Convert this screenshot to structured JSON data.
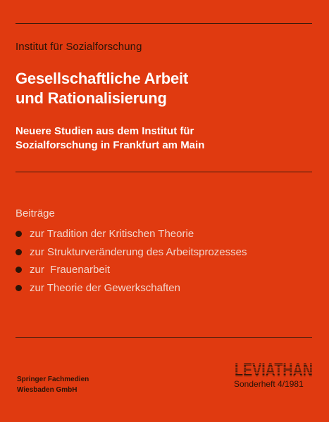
{
  "institute": "Institut für Sozialforschung",
  "title": {
    "line1": "Gesellschaftliche Arbeit",
    "line2": "und Rationalisierung"
  },
  "subtitle": {
    "line1": "Neuere Studien aus dem Institut für",
    "line2": "Sozialforschung in Frankfurt am Main"
  },
  "contributions": {
    "heading": "Beiträge",
    "items": [
      "zur Tradition der Kritischen Theorie",
      "zur Strukturveränderung des Arbeitsprozesses",
      "zur  Frauenarbeit",
      "zur Theorie der Gewerkschaften"
    ]
  },
  "publisher": {
    "line1": "Springer Fachmedien",
    "line2": "Wiesbaden GmbH"
  },
  "series": {
    "logo_text": "LEVIATHAN",
    "issue": "Sonderheft 4/1981"
  },
  "colors": {
    "background": "#e03a10",
    "title_text": "#ffffff",
    "dark_text": "#2a1408"
  }
}
